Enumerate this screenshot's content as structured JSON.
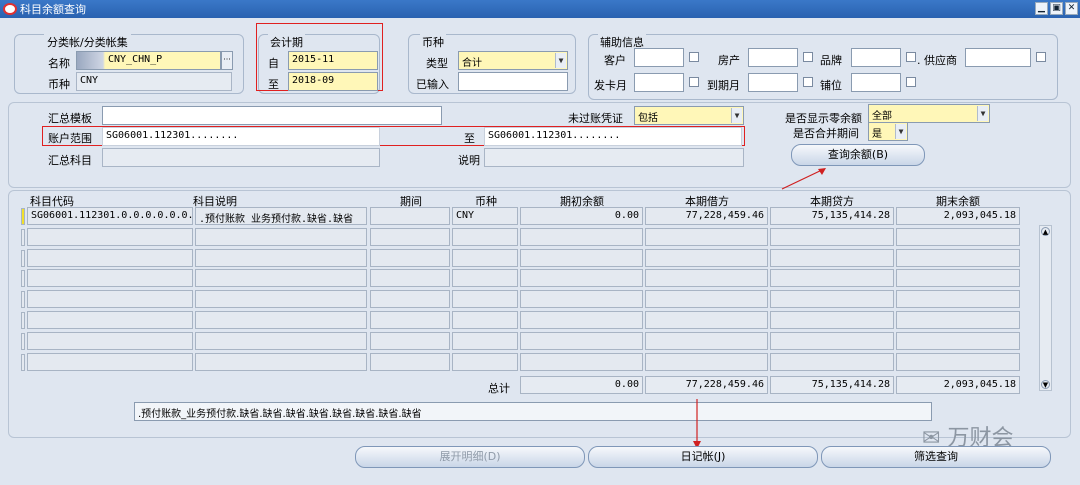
{
  "window": {
    "title": "科目余额查询",
    "controls": [
      "minimize-icon",
      "maximize-icon",
      "close-icon"
    ]
  },
  "ledger": {
    "title": "分类帐/分类帐集",
    "name_label": "名称",
    "name_value": "CNY_CHN_P",
    "currency_label": "币种",
    "currency_value": "CNY"
  },
  "period": {
    "title": "会计期",
    "from_label": "自",
    "from_value": "2015-11",
    "to_label": "至",
    "to_value": "2018-09"
  },
  "currency": {
    "title": "币种",
    "type_label": "类型",
    "type_value": "合计",
    "entered_label": "已输入",
    "entered_value": ""
  },
  "aux": {
    "title": "辅助信息",
    "customer": "客户",
    "property": "房产",
    "brand": "品牌",
    "supplier": ". 供应商",
    "card_month": "发卡月",
    "expiry_month": "到期月",
    "shop": "铺位"
  },
  "filters": {
    "summary_template_label": "汇总模板",
    "summary_template_value": "",
    "unposted_label": "未过账凭证",
    "unposted_value": "包括",
    "account_range_label": "账户范围",
    "account_from": "SG06001.112301........",
    "to_label": "至",
    "account_to": "SG06001.112301........",
    "summary_account_label": "汇总科目",
    "description_label": "说明",
    "show_zero_label": "是否显示零余额",
    "show_zero_value": "全部",
    "merge_period_label": "是否合并期间",
    "merge_period_value": "是"
  },
  "query_button": "查询余额(B)",
  "table": {
    "columns": [
      "科目代码",
      "科目说明",
      "期间",
      "币种",
      "期初余额",
      "本期借方",
      "本期贷方",
      "期末余额"
    ],
    "rows": [
      {
        "code": "SG06001.112301.0.0.0.0.0.0.",
        "desc": ".预付账款_业务预付款.缺省.缺省",
        "period": "",
        "currency": "CNY",
        "opening": "0.00",
        "debit": "77,228,459.46",
        "credit": "75,135,414.28",
        "closing": "2,093,045.18"
      }
    ],
    "total_label": "总计",
    "totals": {
      "opening": "0.00",
      "debit": "77,228,459.46",
      "credit": "75,135,414.28",
      "closing": "2,093,045.18"
    }
  },
  "full_description": ".预付账款_业务预付款.缺省.缺省.缺省.缺省.缺省.缺省.缺省.缺省",
  "buttons": {
    "expand": "展开明细(D)",
    "journal": "日记帐(J)",
    "filter": "筛选查询"
  },
  "watermark": "万财会",
  "colors": {
    "titlebar": "#2a62b0",
    "background": "#dfe6f0",
    "required": "#fff7b8",
    "highlight": "#e02020"
  }
}
